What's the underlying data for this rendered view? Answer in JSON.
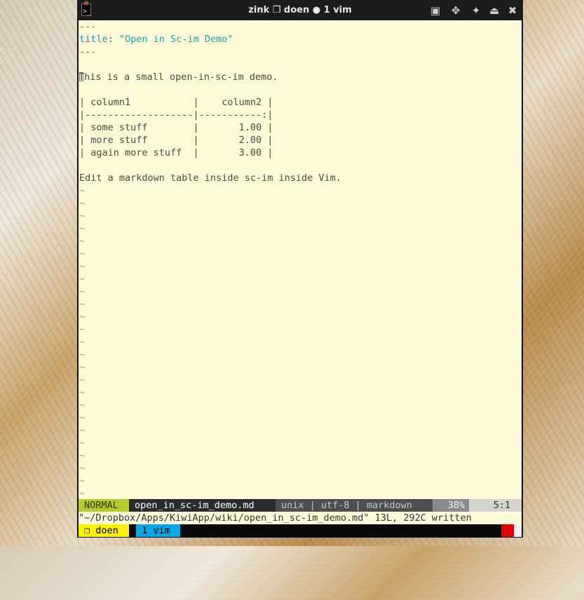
{
  "window": {
    "title": "zink ❐ doen ● 1 vim"
  },
  "titlebar_buttons": [
    {
      "name": "restore-icon",
      "glyph": "▣"
    },
    {
      "name": "move-icon",
      "glyph": "✥"
    },
    {
      "name": "pin-icon",
      "glyph": "✦"
    },
    {
      "name": "shade-icon",
      "glyph": "⏏"
    },
    {
      "name": "close-icon",
      "glyph": "✖"
    }
  ],
  "editor": {
    "frontmatter_open": "---",
    "title_key": "title",
    "title_colon": ": ",
    "title_value": "\"Open in Sc-im Demo\"",
    "frontmatter_close": "---",
    "intro_first": "T",
    "intro_rest": "his is a small open-in-sc-im demo.",
    "table_lines": [
      "| column1           |    column2 |",
      "|-------------------|-----------:|",
      "| some stuff        |       1.00 |",
      "| more stuff        |       2.00 |",
      "| again more stuff  |       3.00 |"
    ],
    "outro": "Edit a markdown table inside sc-im inside Vim.",
    "tilde": "~"
  },
  "statusline": {
    "mode": "NORMAL",
    "filename": "open_in_sc-im_demo.md",
    "fileinfo": "unix | utf-8 | markdown",
    "percent": "38%",
    "position": "5:1"
  },
  "cmdline": {
    "message": "\"~/Dropbox/Apps/KiwiApp/wiki/open_in_sc-im_demo.md\" 13L, 292C written"
  },
  "tmux": {
    "session": "❐ doen",
    "window": "1 vim"
  },
  "colors": {
    "editor_bg": "#fdfbd7",
    "mode_bg": "#b7cc2c",
    "filename_bg": "#2b2b2b",
    "fileinfo_bg": "#4e4e4e",
    "session_bg": "#fff200",
    "window_bg": "#00a8e8",
    "alert_red": "#e00000"
  }
}
